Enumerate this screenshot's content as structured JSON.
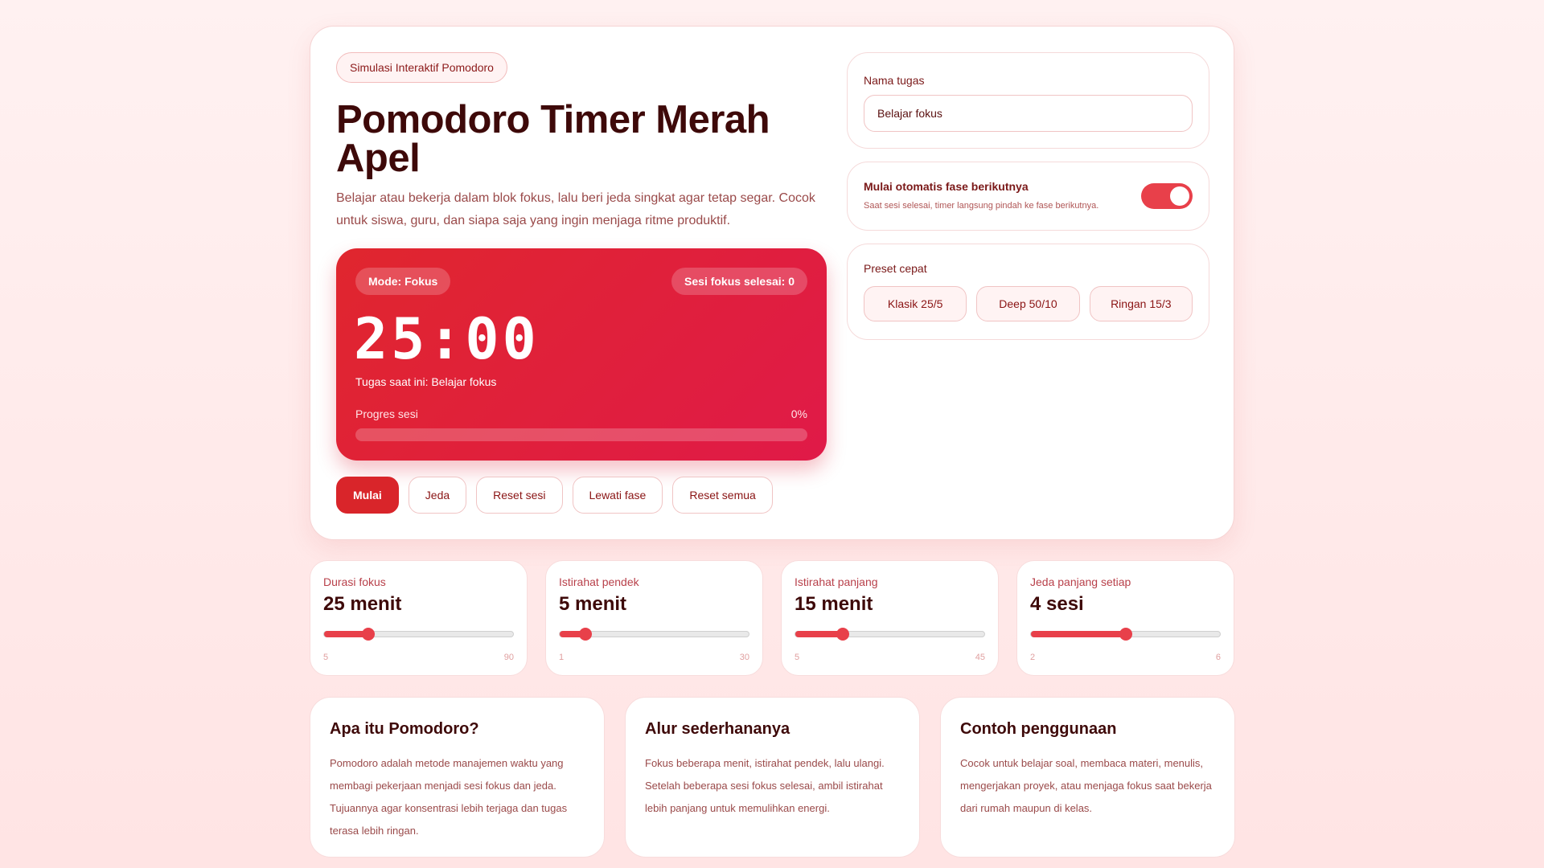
{
  "header": {
    "badge": "Simulasi Interaktif Pomodoro",
    "title": "Pomodoro Timer Merah Apel",
    "description": "Belajar atau bekerja dalam blok fokus, lalu beri jeda singkat agar tetap segar. Cocok untuk siswa, guru, dan siapa saja yang ingin menjaga ritme produktif."
  },
  "timer": {
    "mode": "Mode: Fokus",
    "sessions_done": "Sesi fokus selesai: 0",
    "clock": "25:00",
    "current_task": "Tugas saat ini: Belajar fokus",
    "progress_label": "Progres sesi",
    "progress_text": "0%",
    "progress_fraction": 0
  },
  "controls": {
    "start": "Mulai",
    "pause": "Jeda",
    "reset_session": "Reset sesi",
    "skip_phase": "Lewati fase",
    "reset_all": "Reset semua"
  },
  "task": {
    "label": "Nama tugas",
    "value": "Belajar fokus"
  },
  "auto_start": {
    "label": "Mulai otomatis fase berikutnya",
    "sub": "Saat sesi selesai, timer langsung pindah ke fase berikutnya.",
    "enabled": true
  },
  "presets": {
    "label": "Preset cepat",
    "items": [
      "Klasik 25/5",
      "Deep 50/10",
      "Ringan 15/3"
    ]
  },
  "sliders": [
    {
      "label": "Durasi fokus",
      "value_text": "25 menit",
      "value": 25,
      "min": 5,
      "max": 90,
      "min_text": "5",
      "max_text": "90"
    },
    {
      "label": "Istirahat pendek",
      "value_text": "5 menit",
      "value": 5,
      "min": 1,
      "max": 30,
      "min_text": "1",
      "max_text": "30"
    },
    {
      "label": "Istirahat panjang",
      "value_text": "15 menit",
      "value": 15,
      "min": 5,
      "max": 45,
      "min_text": "5",
      "max_text": "45"
    },
    {
      "label": "Jeda panjang setiap",
      "value_text": "4 sesi",
      "value": 4,
      "min": 2,
      "max": 6,
      "min_text": "2",
      "max_text": "6"
    }
  ],
  "info": [
    {
      "title": "Apa itu Pomodoro?",
      "text": "Pomodoro adalah metode manajemen waktu yang membagi pekerjaan menjadi sesi fokus dan jeda. Tujuannya agar konsentrasi lebih terjaga dan tugas terasa lebih ringan."
    },
    {
      "title": "Alur sederhananya",
      "text": "Fokus beberapa menit, istirahat pendek, lalu ulangi. Setelah beberapa sesi fokus selesai, ambil istirahat lebih panjang untuk memulihkan energi."
    },
    {
      "title": "Contoh penggunaan",
      "text": "Cocok untuk belajar soal, membaca materi, menulis, mengerjakan proyek, atau menjaga fokus saat bekerja dari rumah maupun di kelas."
    }
  ],
  "colors": {
    "accent": "#e8404a",
    "timer_start": "#e0262e",
    "timer_end": "#e01a48",
    "primary_button": "#d9252a"
  }
}
